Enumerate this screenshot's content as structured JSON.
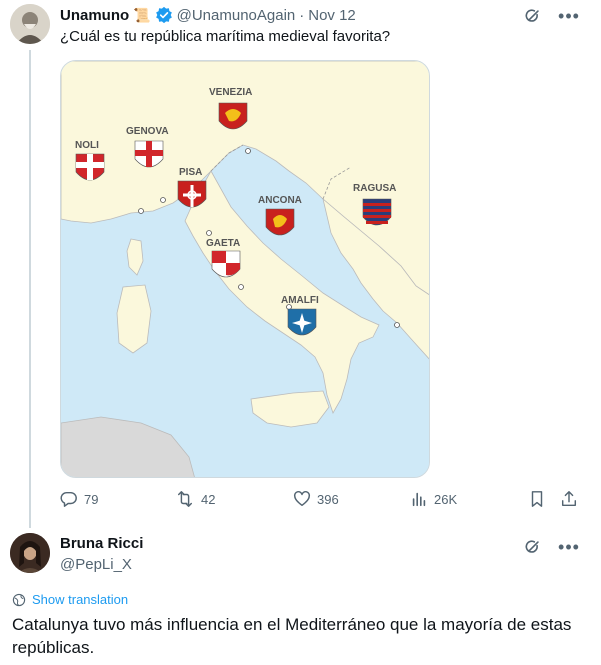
{
  "tweet": {
    "author_name": "Unamuno",
    "author_emoji": "📜",
    "handle": "@UnamunoAgain",
    "separator": "·",
    "date": "Nov 12",
    "text": "¿Cuál es tu república marítima medieval favorita?",
    "map": {
      "cities": [
        {
          "name": "VENEZIA"
        },
        {
          "name": "GENOVA"
        },
        {
          "name": "NOLI"
        },
        {
          "name": "PISA"
        },
        {
          "name": "ANCONA"
        },
        {
          "name": "RAGUSA"
        },
        {
          "name": "GAETA"
        },
        {
          "name": "AMALFI"
        }
      ],
      "colors": {
        "sea": "#cfe9f7",
        "land": "#fbf8dc",
        "other_land": "#d9d9d9",
        "border": "#999999"
      }
    },
    "stats": {
      "replies": "79",
      "retweets": "42",
      "likes": "396",
      "views": "26K"
    }
  },
  "reply": {
    "author_name": "Bruna Ricci",
    "handle": "@PepLi_X",
    "show_translation": "Show translation",
    "text": "Catalunya tuvo más influencia en el Mediterráneo que la mayoría de estas repúblicas."
  },
  "icons": {
    "verified": "verified-badge-icon",
    "grok": "grok-icon",
    "more": "more-icon",
    "reply": "reply-icon",
    "retweet": "retweet-icon",
    "like": "heart-icon",
    "views": "views-icon",
    "bookmark": "bookmark-icon",
    "share": "share-icon",
    "translate": "globe-icon"
  },
  "accent_color": "#1d9bf0"
}
